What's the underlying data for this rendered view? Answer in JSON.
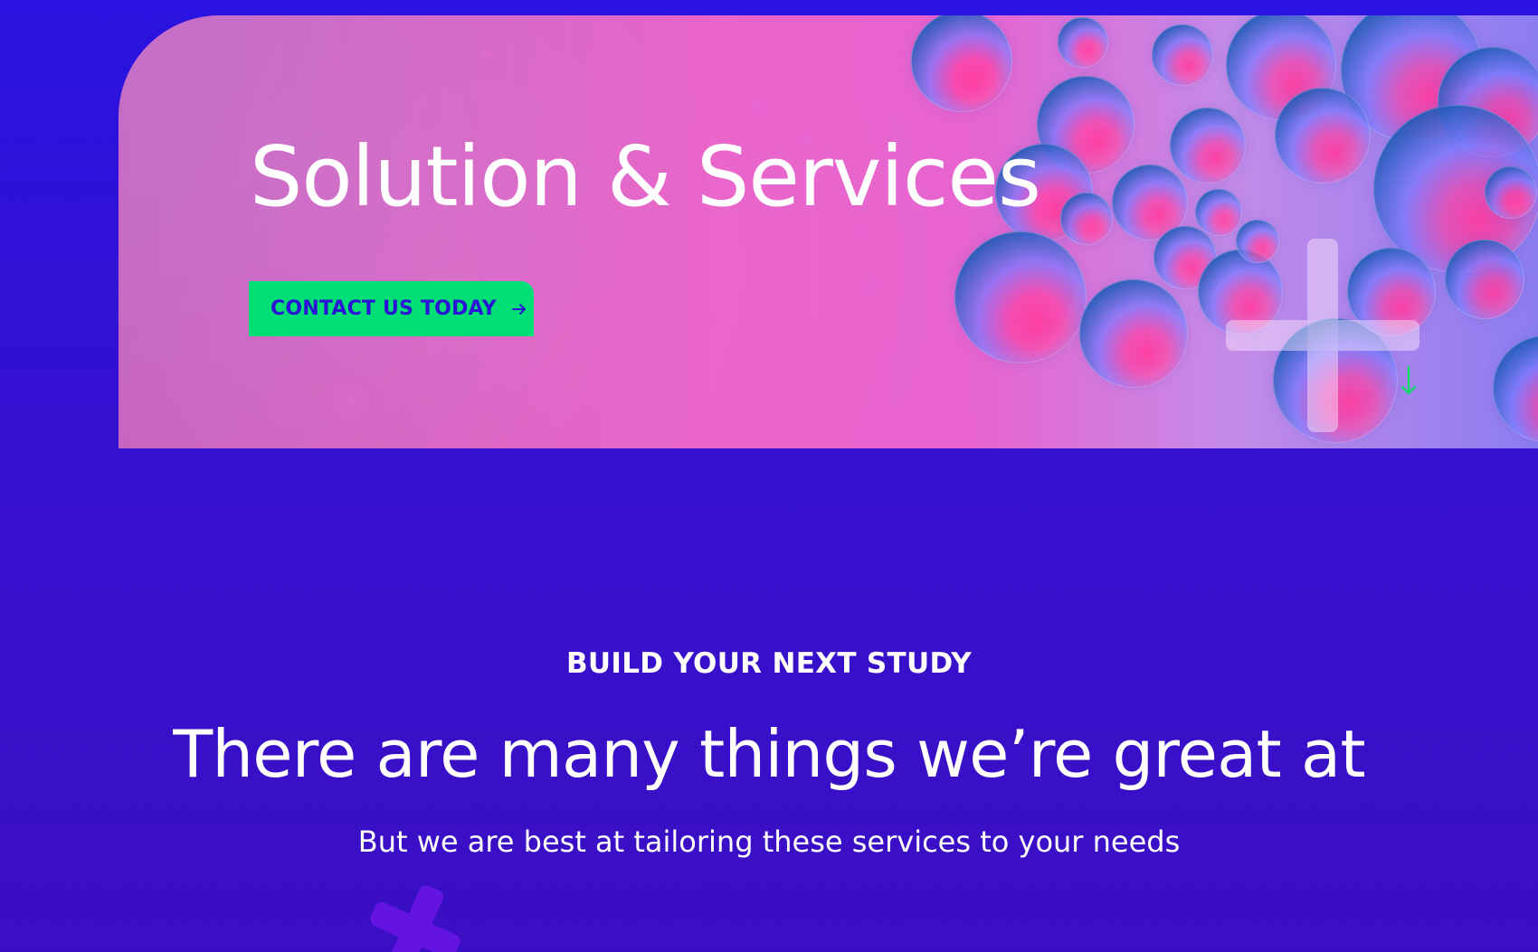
{
  "hero": {
    "title": "Solution & Services",
    "button_label": "CONTACT US TODAY",
    "button_icon": "arrow-right-icon",
    "scroll_icon": "arrow-down-icon",
    "colors": {
      "button_background": "#00df76",
      "button_text": "#2b12d6",
      "page_background": "#2a12e0"
    }
  },
  "section": {
    "kicker": "BUILD YOUR NEXT STUDY",
    "heading": "There are many things we’re great at",
    "subheading": "But we are best at tailoring these services to your needs"
  }
}
